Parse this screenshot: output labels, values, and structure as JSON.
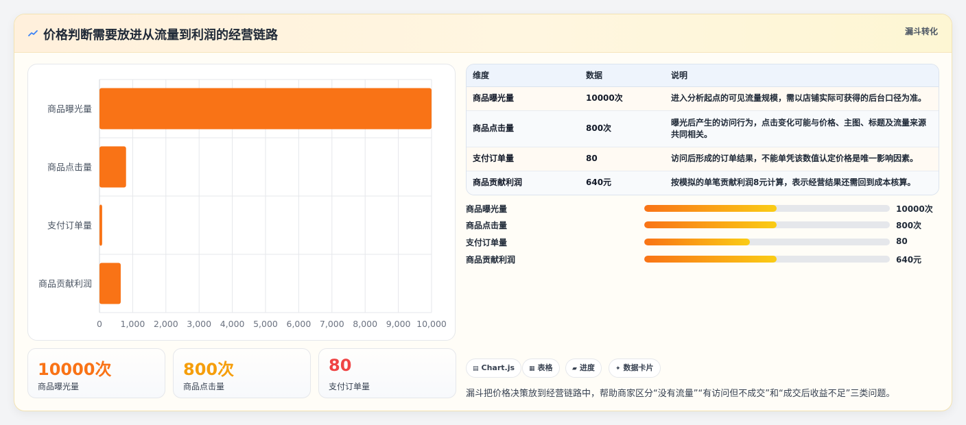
{
  "header": {
    "title": "价格判断需要放进从流量到利润的经营链路",
    "tag": "漏斗转化"
  },
  "colors": {
    "bar": "#f97316",
    "stat1": "#f97316",
    "stat2": "#f59e0b",
    "stat3": "#ef4444"
  },
  "chart_data": {
    "type": "bar",
    "orientation": "horizontal",
    "categories": [
      "商品曝光量",
      "商品点击量",
      "支付订单量",
      "商品贡献利润"
    ],
    "values": [
      10000,
      800,
      80,
      640
    ],
    "xlim": [
      0,
      10000
    ],
    "xticks": [
      0,
      1000,
      2000,
      3000,
      4000,
      5000,
      6000,
      7000,
      8000,
      9000,
      10000
    ],
    "xtick_labels": [
      "0",
      "1,000",
      "2,000",
      "3,000",
      "4,000",
      "5,000",
      "6,000",
      "7,000",
      "8,000",
      "9,000",
      "10,000"
    ],
    "grid": true,
    "legend": "none"
  },
  "stats": [
    {
      "value": "10000次",
      "label": "商品曝光量"
    },
    {
      "value": "800次",
      "label": "商品点击量"
    },
    {
      "value": "80",
      "label": "支付订单量"
    }
  ],
  "table": {
    "headers": [
      "维度",
      "数据",
      "说明"
    ],
    "rows": [
      {
        "dim": "商品曝光量",
        "data": "10000次",
        "desc": "进入分析起点的可见流量规模，需以店铺实际可获得的后台口径为准。"
      },
      {
        "dim": "商品点击量",
        "data": "800次",
        "desc": "曝光后产生的访问行为，点击变化可能与价格、主图、标题及流量来源共同相关。"
      },
      {
        "dim": "支付订单量",
        "data": "80",
        "desc": "访问后形成的订单结果，不能单凭该数值认定价格是唯一影响因素。"
      },
      {
        "dim": "商品贡献利润",
        "data": "640元",
        "desc": "按模拟的单笔贡献利润8元计算，表示经营结果还需回到成本核算。"
      }
    ]
  },
  "progress": [
    {
      "label": "商品曝光量",
      "value": "10000次",
      "fraction": 0.54
    },
    {
      "label": "商品点击量",
      "value": "800次",
      "fraction": 0.54
    },
    {
      "label": "支付订单量",
      "value": "80",
      "fraction": 0.43
    },
    {
      "label": "商品贡献利润",
      "value": "640元",
      "fraction": 0.54
    }
  ],
  "chips": [
    {
      "icon": "chart-icon",
      "glyph": "▤",
      "label": "Chart.js"
    },
    {
      "icon": "table-icon",
      "glyph": "▦",
      "label": "表格"
    },
    {
      "icon": "progress-icon",
      "glyph": "▰",
      "label": "进度"
    },
    {
      "icon": "sparkle-icon",
      "glyph": "✦",
      "label": "数据卡片"
    }
  ],
  "summary": "漏斗把价格决策放到经营链路中，帮助商家区分“没有流量”“有访问但不成交”和“成交后收益不足”三类问题。"
}
